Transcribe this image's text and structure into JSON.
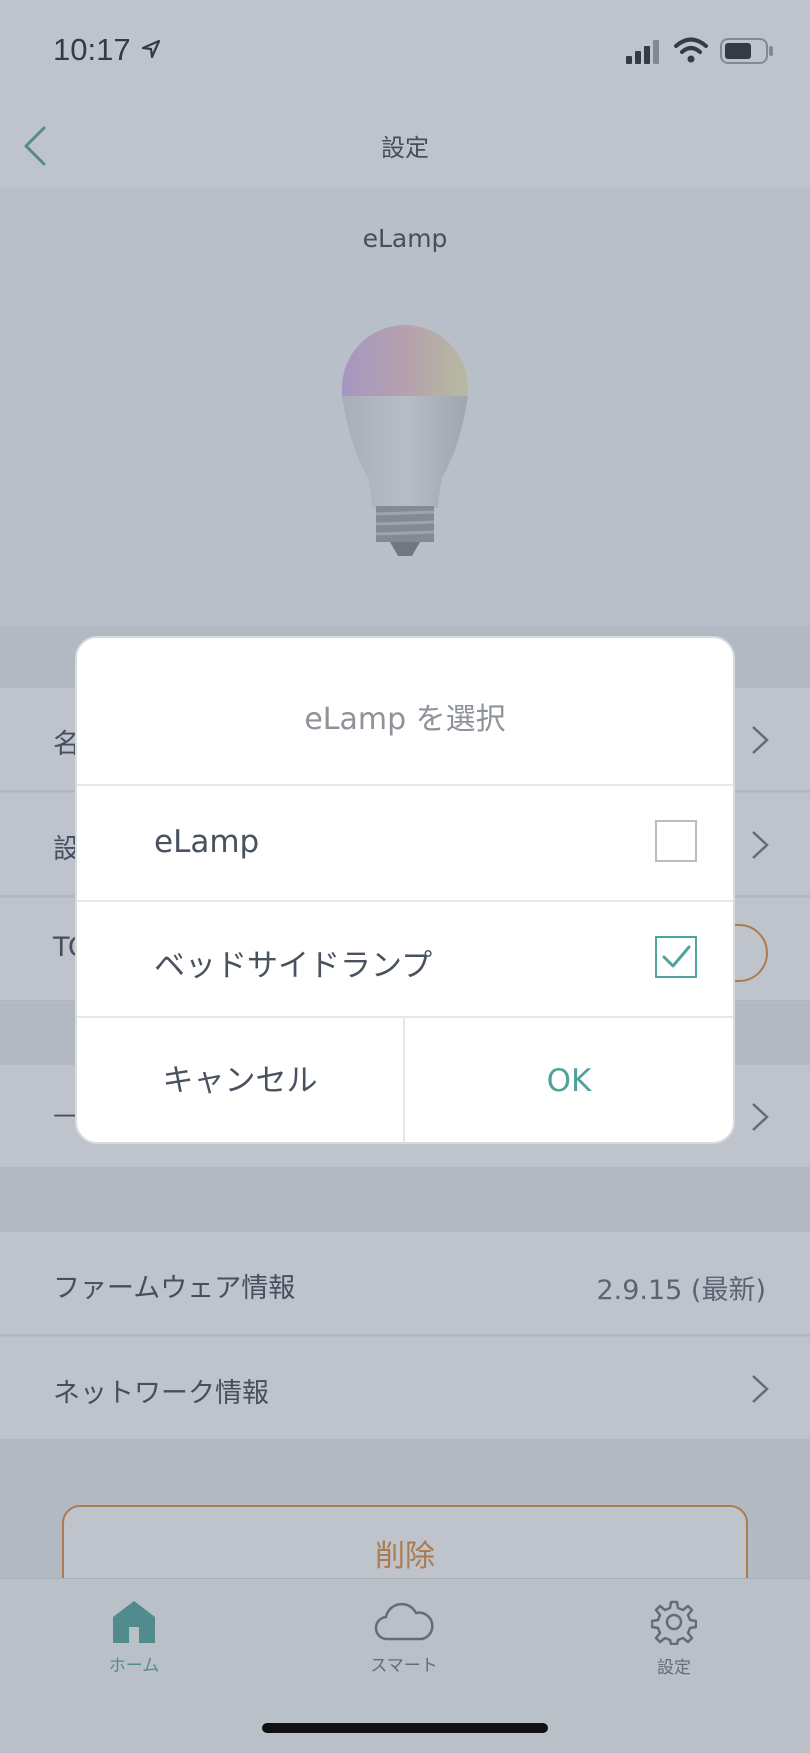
{
  "status": {
    "time": "10:17"
  },
  "nav": {
    "title": "設定"
  },
  "device": {
    "name": "eLamp"
  },
  "rows_hidden": [
    {
      "label_partial": "名"
    },
    {
      "label_partial": "設"
    },
    {
      "label_partial": "TC"
    },
    {
      "label_partial": "—"
    }
  ],
  "info": {
    "firmware_label": "ファームウェア情報",
    "firmware_value": "2.9.15 (最新)",
    "network_label": "ネットワーク情報"
  },
  "delete_label": "削除",
  "tabs": [
    {
      "label": "ホーム",
      "icon": "home-icon",
      "active": true
    },
    {
      "label": "スマート",
      "icon": "cloud-icon",
      "active": false
    },
    {
      "label": "設定",
      "icon": "gear-icon",
      "active": false
    }
  ],
  "dialog": {
    "title": "eLamp を選択",
    "options": [
      {
        "label": "eLamp",
        "checked": false
      },
      {
        "label": "ベッドサイドランプ",
        "checked": true
      }
    ],
    "cancel_label": "キャンセル",
    "ok_label": "OK"
  },
  "colors": {
    "accent": "#4fa39a",
    "danger": "#e08a36"
  }
}
